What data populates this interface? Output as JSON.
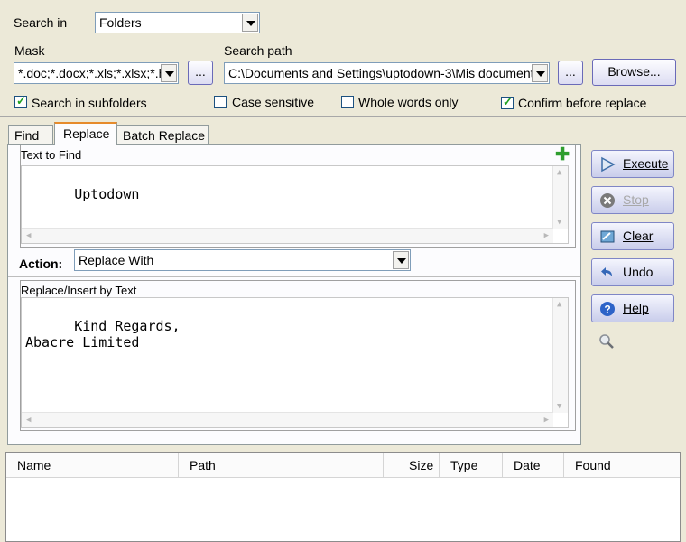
{
  "search_in": {
    "label": "Search in",
    "value": "Folders"
  },
  "mask": {
    "label": "Mask",
    "value": "*.doc;*.docx;*.xls;*.xlsx;*.h",
    "ellipsis": "..."
  },
  "search_path": {
    "label": "Search path",
    "value": "C:\\Documents and Settings\\uptodown-3\\Mis document",
    "ellipsis": "...",
    "browse_label": "Browse..."
  },
  "options": {
    "subfolders": {
      "label": "Search in subfolders",
      "checked": true
    },
    "case_sensitive": {
      "label": "Case sensitive",
      "checked": false
    },
    "whole_words": {
      "label": "Whole words only",
      "checked": false
    },
    "confirm_replace": {
      "label": "Confirm before replace",
      "checked": true
    }
  },
  "tabs": [
    {
      "label": "Find"
    },
    {
      "label": "Replace",
      "active": true
    },
    {
      "label": "Batch Replace"
    }
  ],
  "find_group": {
    "title": "Text to Find",
    "text": "Uptodown"
  },
  "action": {
    "label": "Action:",
    "value": "Replace With"
  },
  "replace_group": {
    "title": "Replace/Insert by Text",
    "text": "Kind Regards,\nAbacre Limited"
  },
  "side_buttons": {
    "execute": "Execute",
    "stop": "Stop",
    "clear": "Clear",
    "undo": "Undo",
    "help": "Help"
  },
  "results_columns": [
    "Name",
    "Path",
    "Size",
    "Type",
    "Date",
    "Found"
  ],
  "colors": {
    "accent_tab": "#e68b2c",
    "check": "#21a121",
    "plus": "#2e9e2e"
  }
}
